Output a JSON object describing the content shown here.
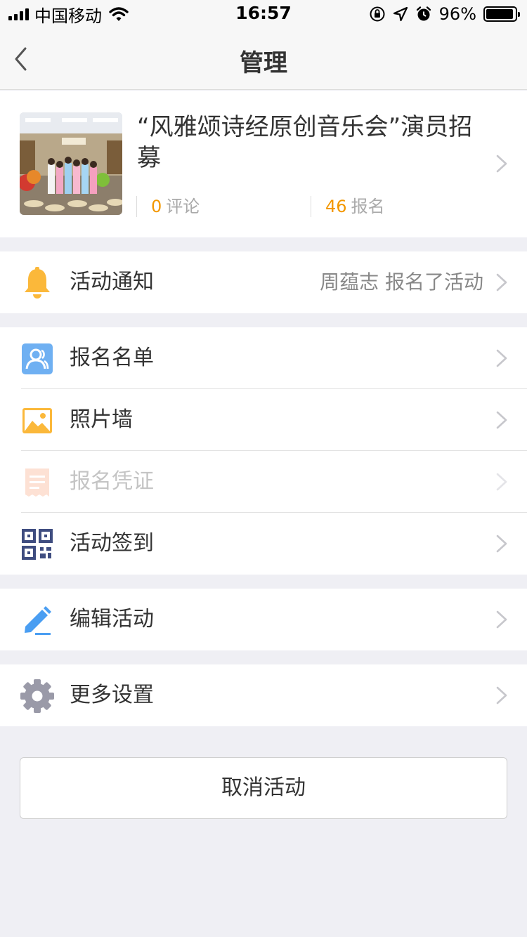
{
  "status_bar": {
    "carrier": "中国移动",
    "time": "16:57",
    "battery": "96%",
    "battery_level": 0.96
  },
  "nav": {
    "title": "管理",
    "back_icon": "chevron-left-icon"
  },
  "event": {
    "title": "“风雅颂诗经原创音乐会”演员招募",
    "comments_count": "0",
    "comments_label": "评论",
    "signups_count": "46",
    "signups_label": "报名"
  },
  "notification": {
    "label": "活动通知",
    "value": "周蕴志 报名了活动",
    "icon": "bell-icon"
  },
  "menu": {
    "signup_list": "报名名单",
    "photo_wall": "照片墙",
    "signup_voucher": "报名凭证",
    "checkin": "活动签到"
  },
  "edit": {
    "label": "编辑活动"
  },
  "settings": {
    "label": "更多设置"
  },
  "cancel_button": "取消活动",
  "colors": {
    "accent_orange": "#f39800",
    "bell": "#fbb83a",
    "user_icon": "#6fb0f2",
    "photo_icon": "#fbb83a",
    "qr_icon": "#3f4d80",
    "pencil_icon": "#4a9ef2",
    "gear_icon": "#9a9aa8"
  }
}
